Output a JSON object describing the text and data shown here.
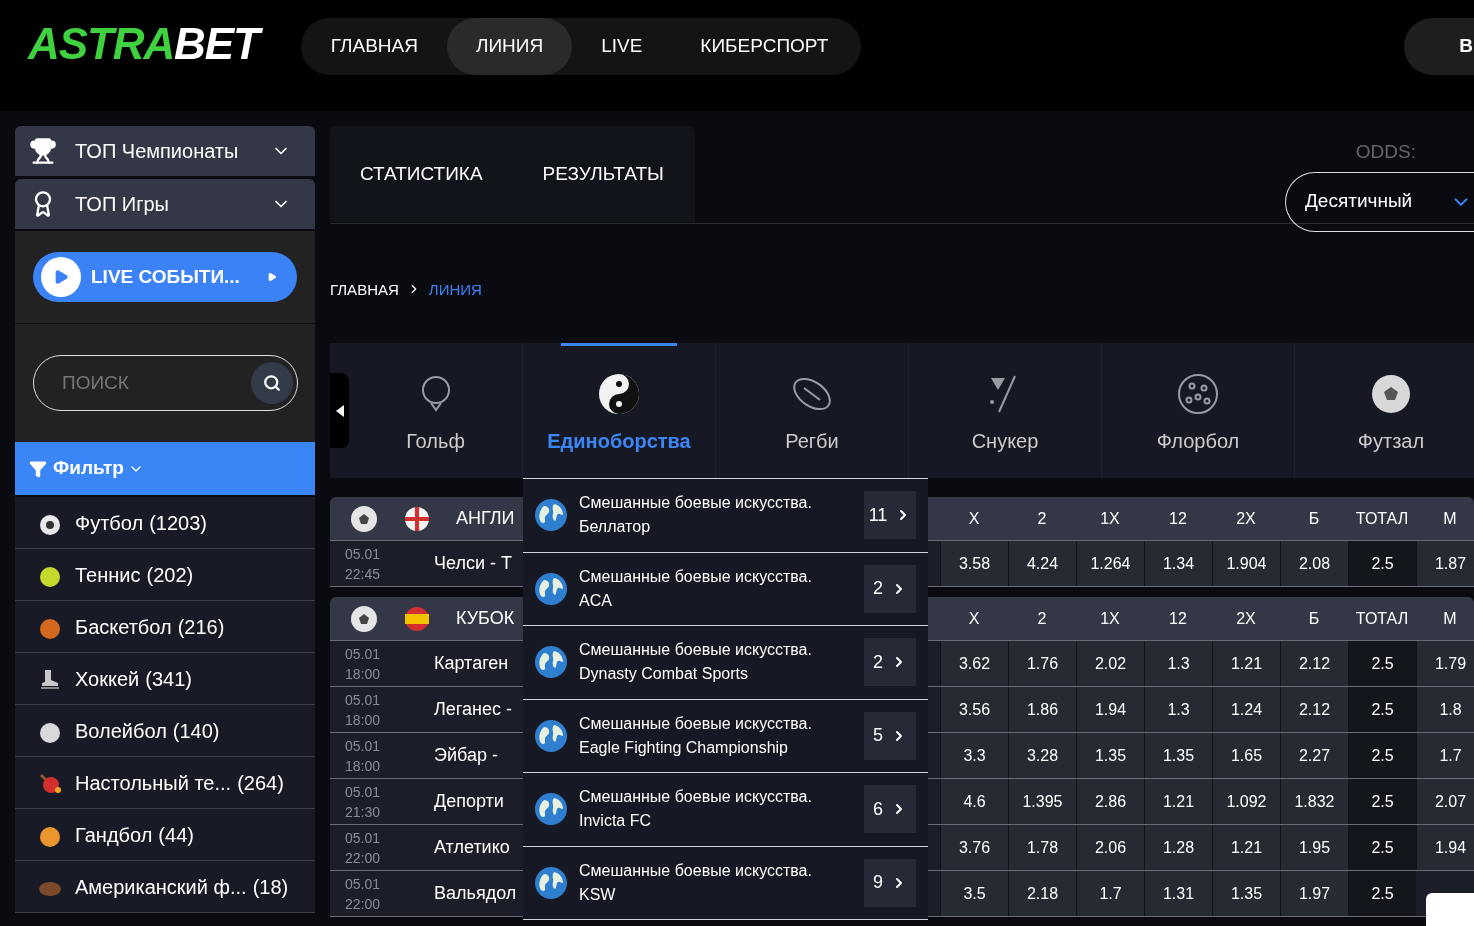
{
  "logo": {
    "accent": "ASTRA",
    "rest": "BET"
  },
  "nav": [
    {
      "label": "ГЛАВНАЯ",
      "selected": false
    },
    {
      "label": "ЛИНИЯ",
      "selected": true
    },
    {
      "label": "LIVE",
      "selected": false
    },
    {
      "label": "КИБЕРСПОРТ",
      "selected": false
    }
  ],
  "header_button": {
    "label": "В"
  },
  "sidebar": {
    "menus": [
      {
        "label": "ТОП Чемпионаты"
      },
      {
        "label": "ТОП Игры"
      }
    ],
    "live_button": {
      "label": "LIVE СОБЫТИ..."
    },
    "search": {
      "placeholder": "ПОИСК"
    },
    "filter": {
      "label": "Фильтр"
    },
    "sports": [
      {
        "label": "Футбол",
        "count": "(1203)"
      },
      {
        "label": "Теннис",
        "count": "(202)"
      },
      {
        "label": "Баскетбол",
        "count": "(216)"
      },
      {
        "label": "Хоккей",
        "count": "(341)"
      },
      {
        "label": "Волейбол",
        "count": "(140)"
      },
      {
        "label": "Настольный те...",
        "count": "(264)"
      },
      {
        "label": "Гандбол",
        "count": "(44)"
      },
      {
        "label": "Американский ф...",
        "count": "(18)"
      }
    ]
  },
  "info_tabs": [
    {
      "label": "СТАТИСТИКА"
    },
    {
      "label": "РЕЗУЛЬТАТЫ"
    }
  ],
  "odds": {
    "label": "ODDS:",
    "value": "Десятичный"
  },
  "breadcrumb": [
    {
      "label": "ГЛАВНАЯ",
      "current": false
    },
    {
      "label": "ЛИНИЯ",
      "current": true
    }
  ],
  "sport_tabs": [
    {
      "label": "Гольф",
      "selected": false
    },
    {
      "label": "Единоборства",
      "selected": true
    },
    {
      "label": "Регби",
      "selected": false
    },
    {
      "label": "Снукер",
      "selected": false
    },
    {
      "label": "Флорбол",
      "selected": false
    },
    {
      "label": "Футзал",
      "selected": false
    }
  ],
  "leagues": [
    {
      "name": "АНГЛИ",
      "flag": {
        "kind": "england"
      },
      "columns": [
        {
          "label": "X",
          "kind": "odd"
        },
        {
          "label": "2",
          "kind": "odd"
        },
        {
          "label": "1X",
          "kind": "odd"
        },
        {
          "label": "12",
          "kind": "odd"
        },
        {
          "label": "2X",
          "kind": "odd"
        },
        {
          "label": "Б",
          "kind": "odd"
        },
        {
          "label": "ТОТАЛ",
          "kind": "param"
        },
        {
          "label": "М",
          "kind": "odd"
        }
      ],
      "matches": [
        {
          "date": "05.01",
          "time": "22:45",
          "teams": "Челси - Т",
          "odds": [
            "3.58",
            "4.24",
            "1.264",
            "1.34",
            "1.904",
            "2.08",
            "2.5",
            "1.87"
          ]
        }
      ]
    },
    {
      "name": "КУБОК",
      "flag": {
        "kind": "spain"
      },
      "columns": [
        {
          "label": "X",
          "kind": "odd"
        },
        {
          "label": "2",
          "kind": "odd"
        },
        {
          "label": "1X",
          "kind": "odd"
        },
        {
          "label": "12",
          "kind": "odd"
        },
        {
          "label": "2X",
          "kind": "odd"
        },
        {
          "label": "Б",
          "kind": "odd"
        },
        {
          "label": "ТОТАЛ",
          "kind": "param"
        },
        {
          "label": "М",
          "kind": "odd"
        }
      ],
      "matches": [
        {
          "date": "05.01",
          "time": "18:00",
          "teams": "Картаген",
          "odds": [
            "3.62",
            "1.76",
            "2.02",
            "1.3",
            "1.21",
            "2.12",
            "2.5",
            "1.79"
          ]
        },
        {
          "date": "05.01",
          "time": "18:00",
          "teams": "Леганес -",
          "odds": [
            "3.56",
            "1.86",
            "1.94",
            "1.3",
            "1.24",
            "2.12",
            "2.5",
            "1.8"
          ]
        },
        {
          "date": "05.01",
          "time": "18:00",
          "teams": "Эйбар -",
          "odds": [
            "3.3",
            "3.28",
            "1.35",
            "1.35",
            "1.65",
            "2.27",
            "2.5",
            "1.7"
          ]
        },
        {
          "date": "05.01",
          "time": "21:30",
          "teams": "Депорти",
          "odds": [
            "4.6",
            "1.395",
            "2.86",
            "1.21",
            "1.092",
            "1.832",
            "2.5",
            "2.07"
          ]
        },
        {
          "date": "05.01",
          "time": "22:00",
          "teams": "Атлетико",
          "odds": [
            "3.76",
            "1.78",
            "2.06",
            "1.28",
            "1.21",
            "1.95",
            "2.5",
            "1.94"
          ]
        },
        {
          "date": "05.01",
          "time": "22:00",
          "teams": "Вальядол",
          "odds": [
            "3.5",
            "2.18",
            "1.7",
            "1.31",
            "1.35",
            "1.97",
            "2.5"
          ]
        }
      ]
    }
  ],
  "dropdown": {
    "items": [
      {
        "title": "Смешанные боевые искусства. Беллатор",
        "count": "11"
      },
      {
        "title": "Смешанные боевые искусства. ACA",
        "count": "2"
      },
      {
        "title": "Смешанные боевые искусства. Dynasty Combat Sports",
        "count": "2"
      },
      {
        "title": "Смешанные боевые искусства. Eagle Fighting Championship",
        "count": "5"
      },
      {
        "title": "Смешанные боевые искусства. Invicta FC",
        "count": "6"
      },
      {
        "title": "Смешанные боевые искусства. KSW",
        "count": "9"
      }
    ]
  }
}
